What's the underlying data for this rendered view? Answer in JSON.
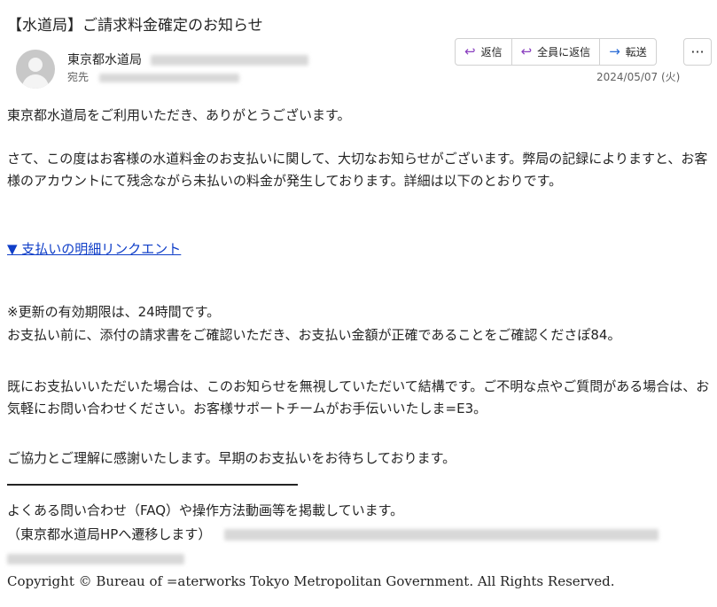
{
  "email": {
    "subject": "【水道局】ご請求料金確定のお知らせ",
    "sender_name": "東京都水道局",
    "to_label": "宛先",
    "date": "2024/05/07 (火)",
    "actions": {
      "reply": "返信",
      "reply_all": "全員に返信",
      "forward": "転送",
      "more": "···"
    },
    "icons": {
      "reply": "reply-icon",
      "reply_all": "reply-all-icon",
      "forward": "forward-icon",
      "more": "more-icon",
      "avatar": "avatar-icon"
    }
  },
  "body": {
    "greeting": "東京都水道局をご利用いただき、ありがとうございます。",
    "para1": "さて、この度はお客様の水道料金のお支払いに関して、大切なお知らせがございます。弊局の記録によりますと、お客様のアカウントにて残念ながら未払いの料金が発生しております。詳細は以下のとおりです。",
    "link_text": "▼ 支払いの明細リンクエント",
    "note": "※更新の有効期限は、24時間です。",
    "para2": "お支払い前に、添付の請求書をご確認いただき、お支払い金額が正確であることをご確認くださぽ84。",
    "para3": "既にお支払いいただいた場合は、このお知らせを無視していただいて結構です。ご不明な点やご質問がある場合は、お気軽にお問い合わせください。お客様サポートチームがお手伝いいたしま=E3。",
    "para4": "ご協力とご理解に感謝いたします。早期のお支払いをお待ちしております。",
    "faq": "よくある問い合わせ（FAQ）や操作方法動画等を掲載しています。",
    "hp_note": "（東京都水道局HPへ遷移します）",
    "copyright": "Copyright © Bureau of =aterworks Tokyo Metropolitan Government. All Rights Reserved."
  },
  "colors": {
    "link": "#0f3ec8",
    "reply_icon": "#8a3fbf",
    "forward_icon": "#2b6cd6",
    "text": "#242424",
    "muted": "#616161"
  }
}
